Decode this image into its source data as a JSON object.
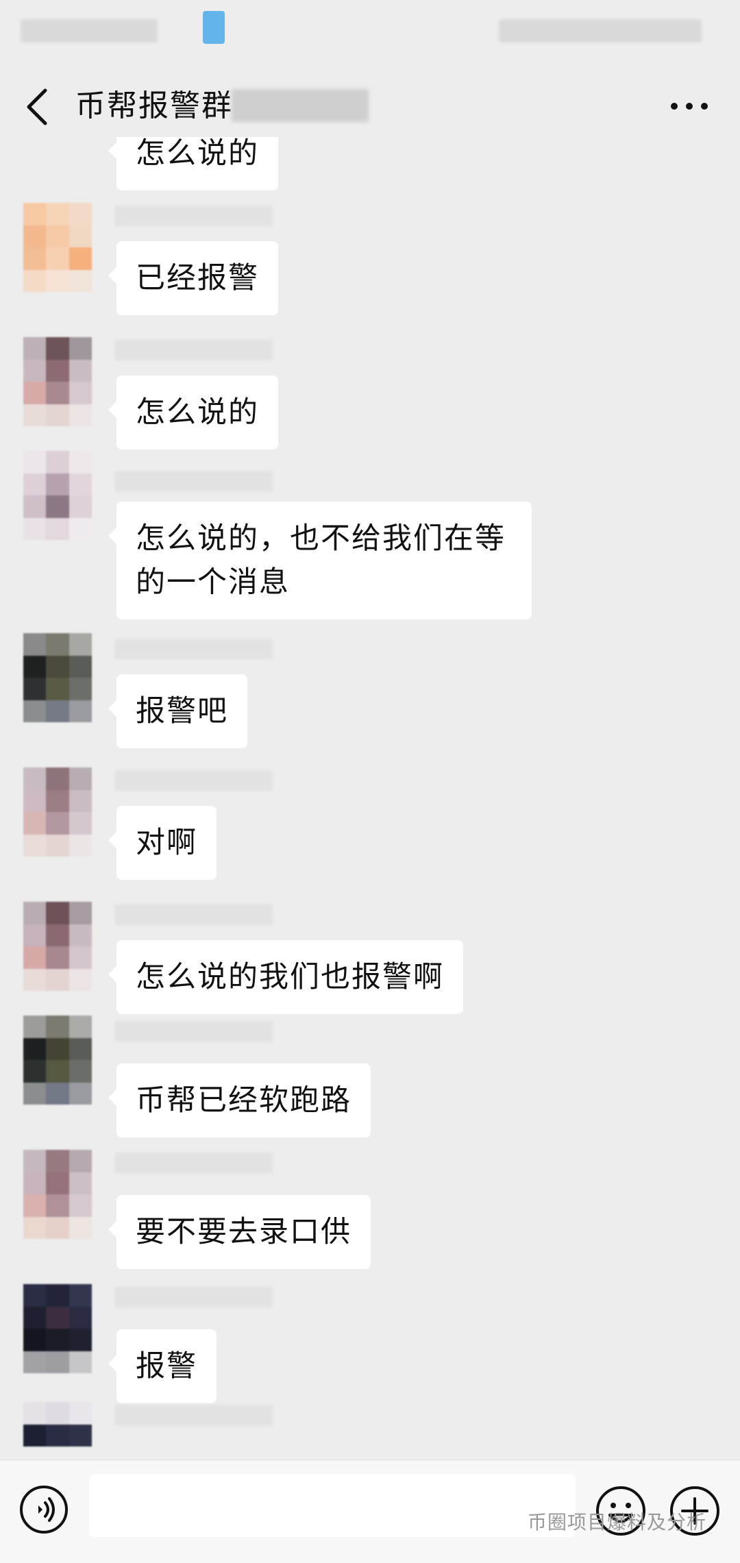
{
  "header": {
    "title": "币帮报警群"
  },
  "messages": [
    {
      "text": "怎么说的"
    },
    {
      "text": "已经报警"
    },
    {
      "text": "怎么说的"
    },
    {
      "text": "怎么说的，也不给我们在等的一个消息"
    },
    {
      "text": "报警吧"
    },
    {
      "text": "对啊"
    },
    {
      "text": "怎么说的我们也报警啊"
    },
    {
      "text": "币帮已经软跑路"
    },
    {
      "text": "要不要去录口供"
    },
    {
      "text": "报警"
    }
  ],
  "watermark": "币圈项目爆料及分析",
  "icons": {
    "back": "back-arrow-icon",
    "more": "more-options-icon",
    "voice": "voice-input-icon",
    "emoji": "emoji-icon",
    "plus": "plus-icon"
  }
}
